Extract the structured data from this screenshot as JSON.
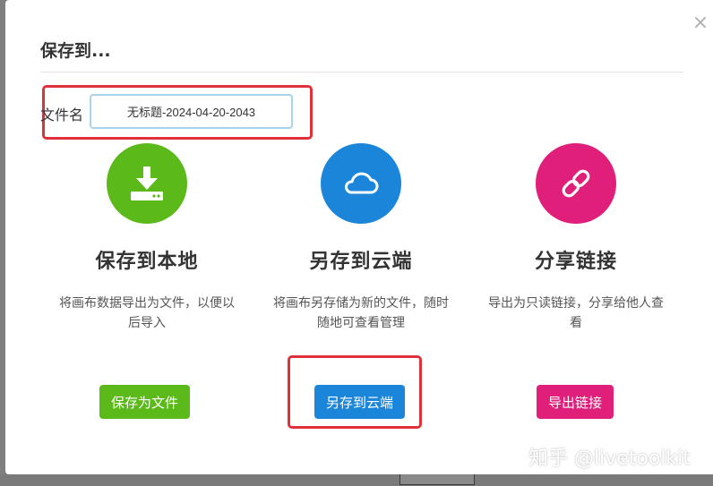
{
  "dialog": {
    "title": "保存到...",
    "close_symbol": "×"
  },
  "filename": {
    "label": "文件名",
    "value": "无标题-2024-04-20-2043"
  },
  "options": [
    {
      "heading": "保存到本地",
      "description": "将画布数据导出为文件，以便以后导入",
      "button_label": "保存为文件",
      "icon": "download-icon",
      "color": "#5bb91a"
    },
    {
      "heading": "另存到云端",
      "description": "将画布另存储为新的文件，随时随地可查看管理",
      "button_label": "另存到云端",
      "icon": "cloud-icon",
      "color": "#1b86d9"
    },
    {
      "heading": "分享链接",
      "description": "导出为只读链接，分享给他人查看",
      "button_label": "导出链接",
      "icon": "link-icon",
      "color": "#e01f7a"
    }
  ],
  "watermark": "知乎 @livetoolkit",
  "highlight_color": "#e0303a"
}
